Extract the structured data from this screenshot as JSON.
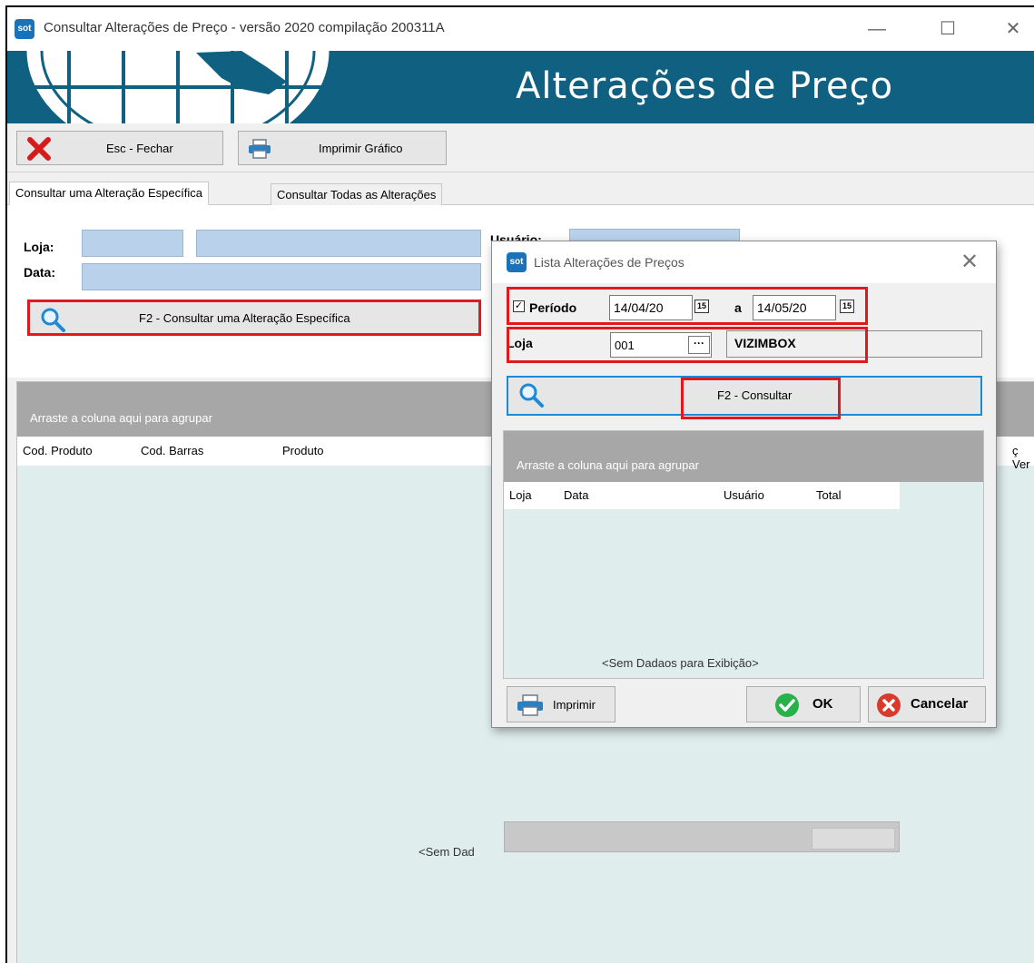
{
  "window": {
    "title": "Consultar Alterações de Preço -  versão 2020 compilação 200311A",
    "icon_text": "sot",
    "minimize": "—",
    "maximize": "☐",
    "close": "✕"
  },
  "banner": {
    "title": "Alterações de Preço"
  },
  "toolbar": {
    "close_label": "Esc - Fechar",
    "print_chart_label": "Imprimir Gráfico"
  },
  "tabs": [
    {
      "label": "Consultar uma Alteração Específica",
      "active": true
    },
    {
      "label": "Consultar Todas as Alterações",
      "active": false
    }
  ],
  "filters": {
    "store_label": "Loja:",
    "date_label": "Data:",
    "user_label": "Usuário:",
    "consult_specific_label": "F2 - Consultar uma Alteração Específica"
  },
  "main_grid": {
    "group_hint": "Arraste a coluna aqui para agrupar",
    "columns": [
      "Cod. Produto",
      "Cod. Barras",
      "Produto",
      "ç Ver"
    ],
    "empty_text": "<Sem Dad"
  },
  "dialog": {
    "title": "Lista Alterações de Preços",
    "icon_text": "sot",
    "close": "✕",
    "period_label": "Período",
    "period_checked": true,
    "checkbox_mark": "✓",
    "date_from": "14/04/20",
    "date_sep": "a",
    "date_to": "14/05/20",
    "calendar_icon_text": "15",
    "store_label": "Loja",
    "store_code": "001",
    "store_lookup": "···",
    "store_name": "VIZIMBOX",
    "consult_label": "F2 - Consultar",
    "grid": {
      "group_hint": "Arraste a coluna aqui para agrupar",
      "columns": [
        "Loja",
        "Data",
        "Usuário",
        "Total"
      ],
      "empty_text": "<Sem Dadaos para Exibição>"
    },
    "print_label": "Imprimir",
    "ok_label": "OK",
    "cancel_label": "Cancelar"
  },
  "colors": {
    "banner": "#0f6081",
    "highlight": "#e0191d",
    "field_blue": "#b9d1ea",
    "grid_bg": "#dfeeed",
    "group_header": "#a7a7a7"
  }
}
